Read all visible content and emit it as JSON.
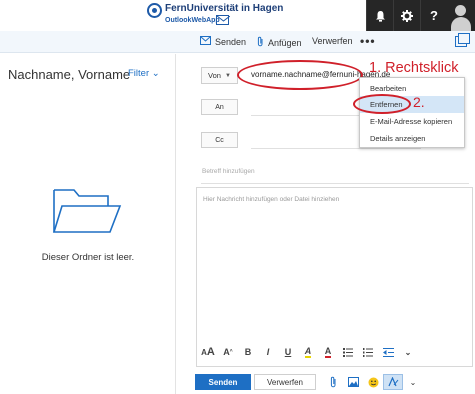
{
  "header": {
    "logo_name": "FernUniversität in Hagen",
    "logo_sub": "OutlookWebApp",
    "icons": [
      "bell-icon",
      "gear-icon",
      "help-icon",
      "avatar"
    ],
    "help_label": "?"
  },
  "commandbar": {
    "send_label": "Senden",
    "attach_label": "Anfügen",
    "discard_label": "Verwerfen",
    "more_label": "•••"
  },
  "leftpane": {
    "folder_title": "Nachname, Vorname",
    "filter_label": "Filter",
    "empty_text": "Dieser Ordner ist leer."
  },
  "compose": {
    "from_label": "Von",
    "from_address": "vorname.nachname@fernuni-hagen.de",
    "to_label": "An",
    "cc_label": "Cc",
    "subject_placeholder": "Betreff hinzufügen",
    "body_placeholder": "Hier Nachricht hinzufügen oder Datei hinziehen",
    "send_label": "Senden",
    "discard_label": "Verwerfen"
  },
  "context_menu": {
    "items": [
      {
        "label": "Bearbeiten",
        "highlighted": false
      },
      {
        "label": "Entfernen",
        "highlighted": true
      },
      {
        "label": "E-Mail-Adresse kopieren",
        "highlighted": false
      },
      {
        "label": "Details anzeigen",
        "highlighted": false
      }
    ]
  },
  "annotations": {
    "step1": "1. Rechtsklick",
    "step2": "2.",
    "color": "#d0202a"
  },
  "colors": {
    "accent": "#1e6fc4",
    "topbar_dark": "#262626",
    "commandbar_bg": "#f2f7fc",
    "menu_highlight": "#d4e6f7"
  },
  "format_toolbar": {
    "glyphs": [
      "AA",
      "A",
      "B",
      "I",
      "U",
      "A",
      "A",
      "☰",
      "☰",
      "⇤",
      "⌄"
    ]
  }
}
